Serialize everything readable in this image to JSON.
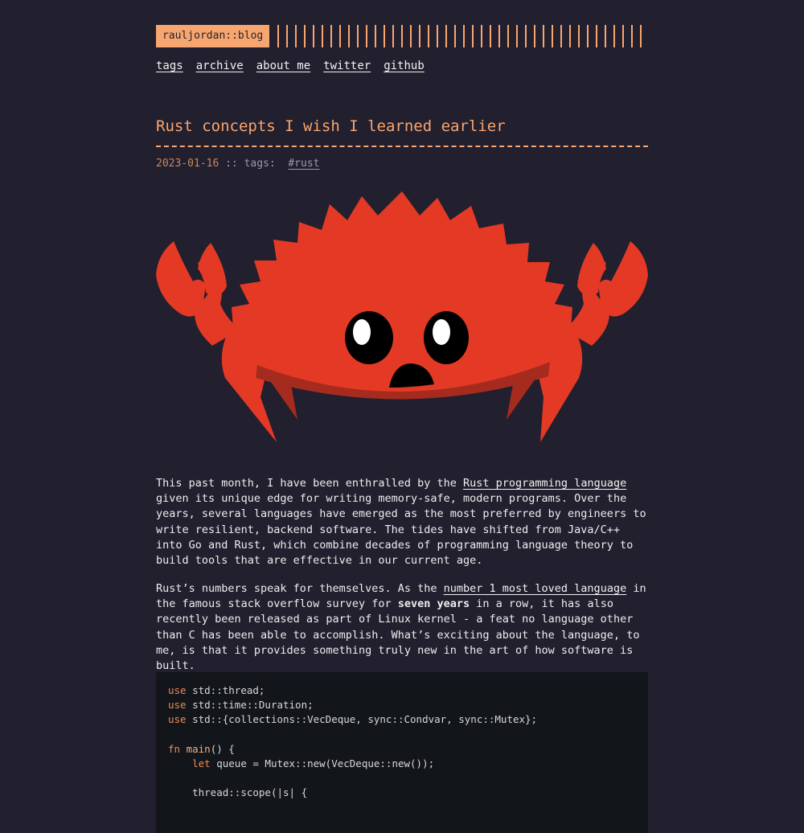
{
  "header": {
    "logo": "rauljordan::blog"
  },
  "nav": [
    "tags",
    "archive",
    "about me",
    "twitter",
    "github"
  ],
  "post": {
    "title": "Rust concepts I wish I learned earlier",
    "date": "2023-01-16",
    "meta_sep": " :: tags:  ",
    "tag": "#rust"
  },
  "hero": {
    "icon": "ferris-crab-icon",
    "body_color": "#e43a25",
    "shadow_color": "#a52b1f"
  },
  "para1": {
    "before": "This past month, I have been enthralled by the ",
    "link": "Rust programming language",
    "after": " given its unique edge for writing memory-safe, modern programs. Over the years, several languages have emerged as the most preferred by engineers to write resilient, backend software. The tides have shifted from Java/C++ into Go and Rust, which combine decades of programming language theory to build tools that are effective in our current age."
  },
  "para2": {
    "before": "Rust’s numbers speak for themselves. As the ",
    "link": "number 1 most loved language",
    "middle": " in the famous stack overflow survey for ",
    "bold": "seven years",
    "after": " in a row, it has also recently been released as part of Linux kernel - a feat no language other than C has been able to accomplish. What’s exciting about the language, to me, is that it provides something truly new in the art of how software is built."
  },
  "code": {
    "kw_use": "use",
    "line1": "std::thread;",
    "line2": "std::time::Duration;",
    "line3": "std::{collections::VecDeque, sync::Condvar, sync::Mutex};",
    "kw_fn": "fn",
    "fn_name": "main",
    "fn_rest": "() {",
    "kw_let": "let",
    "let_rest": " queue = Mutex::new(VecDeque::new());",
    "scope_line": "thread::scope(|s| {"
  },
  "colors": {
    "accent": "#f8a66f",
    "background": "#221f2e",
    "code_bg": "#121519"
  }
}
